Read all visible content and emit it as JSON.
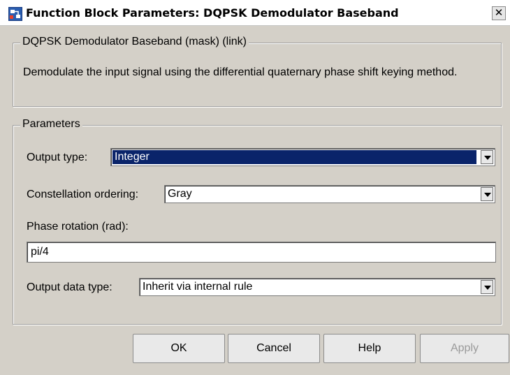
{
  "window": {
    "title": "Function Block Parameters: DQPSK Demodulator Baseband",
    "close_glyph": "✕"
  },
  "mask": {
    "legend": "DQPSK Demodulator Baseband (mask) (link)",
    "description": "Demodulate the input signal using the differential quaternary phase shift keying method."
  },
  "parameters": {
    "legend": "Parameters",
    "output_type": {
      "label": "Output type:",
      "value": "Integer"
    },
    "constellation_ordering": {
      "label": "Constellation ordering:",
      "value": "Gray"
    },
    "phase_rotation": {
      "label": "Phase rotation (rad):",
      "value": "pi/4"
    },
    "output_data_type": {
      "label": "Output data type:",
      "value": "Inherit via internal rule"
    }
  },
  "buttons": {
    "ok": "OK",
    "cancel": "Cancel",
    "help": "Help",
    "apply": "Apply"
  },
  "colors": {
    "dialog_bg": "#d4d0c8",
    "selection": "#0a246a"
  },
  "icons": [
    "simulink-block-icon",
    "close-icon",
    "dropdown-arrow-icon"
  ]
}
